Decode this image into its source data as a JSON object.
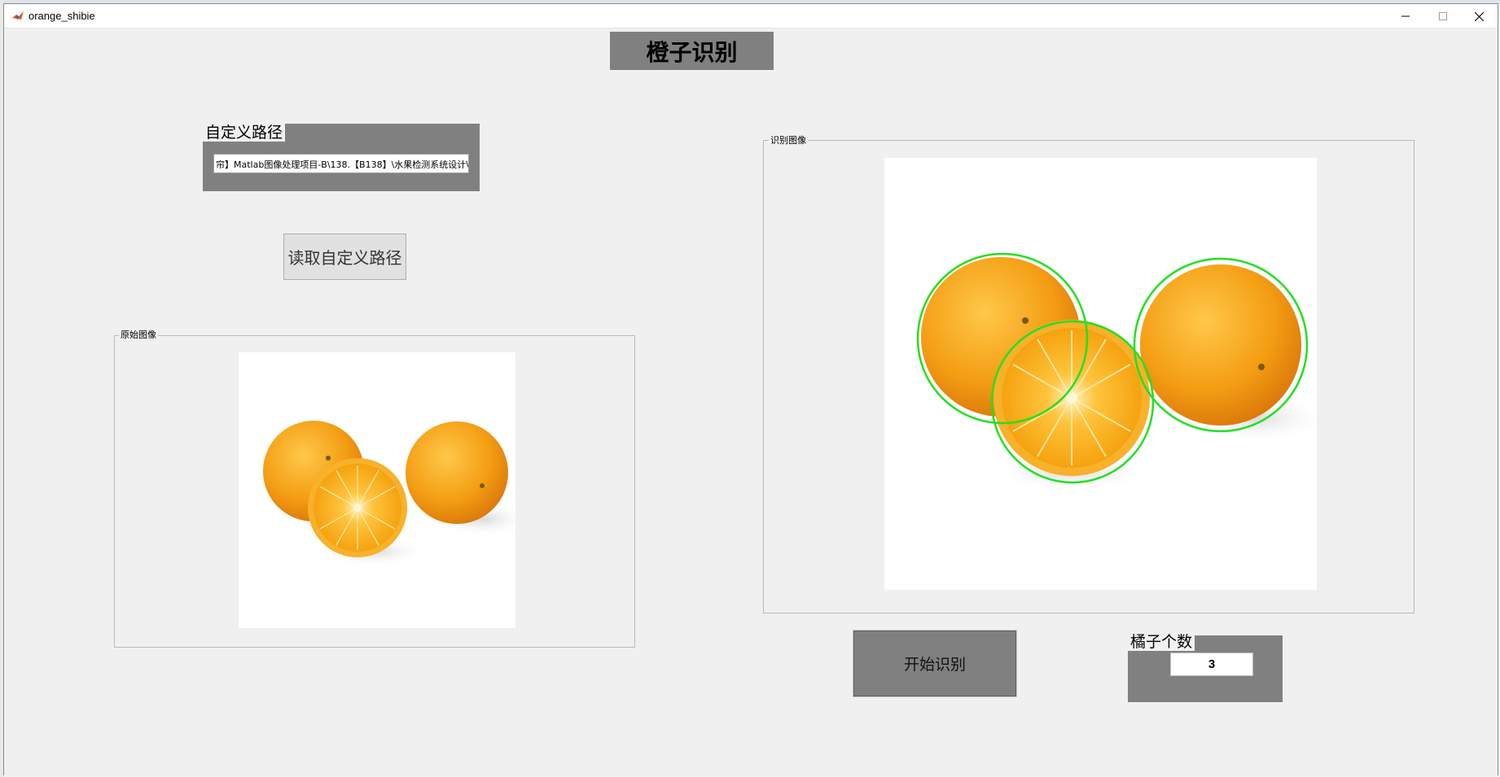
{
  "window": {
    "title": "orange_shibie",
    "icon": "matlab-icon"
  },
  "main": {
    "title": "橙子识别",
    "path_panel": {
      "title": "自定义路径",
      "path_value": "帘】Matlab图像处理项目-B\\138.【B138】\\水果检测系统设计\\a.jp"
    },
    "read_path_button": "读取自定义路径",
    "original_image_group": "原始图像",
    "result_image_group": "识别图像",
    "start_button": "开始识别",
    "count_panel": {
      "title": "橘子个数",
      "value": "3"
    }
  },
  "colors": {
    "panel_gray": "#808080",
    "background": "#f0f0f0",
    "detection_circle": "#22e022",
    "orange": "#f6a21a"
  }
}
